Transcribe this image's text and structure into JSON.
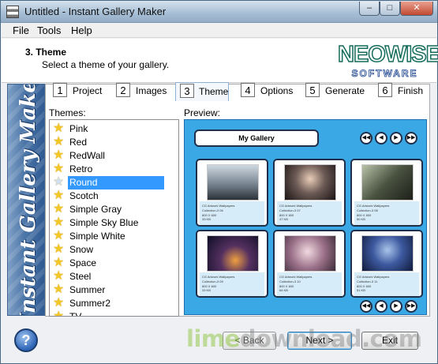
{
  "window": {
    "title": "Untitled - Instant Gallery Maker",
    "controls": {
      "minimize": "–",
      "maximize": "□",
      "close": "✕"
    }
  },
  "menu": [
    "File",
    "Tools",
    "Help"
  ],
  "header": {
    "step_title": "3. Theme",
    "step_desc": "Select a theme of your gallery.",
    "logo_top": "NEOWISE",
    "logo_bottom": "SOFTWARE"
  },
  "sidebar_text": "Instant Gallery Maker",
  "tabs": [
    {
      "num": "1",
      "label": "Project"
    },
    {
      "num": "2",
      "label": "Images"
    },
    {
      "num": "3",
      "label": "Theme",
      "active": true
    },
    {
      "num": "4",
      "label": "Options"
    },
    {
      "num": "5",
      "label": "Generate"
    },
    {
      "num": "6",
      "label": "Finish"
    }
  ],
  "themes_label": "Themes:",
  "preview_label": "Preview:",
  "themes": [
    "Pink",
    "Red",
    "RedWall",
    "Retro",
    "Round",
    "Scotch",
    "Simple Gray",
    "Simple Sky Blue",
    "Simple White",
    "Snow",
    "Space",
    "Steel",
    "Summer",
    "Summer2",
    "TV"
  ],
  "selected_theme": "Round",
  "preview": {
    "gallery_title": "My Gallery",
    "nav": [
      "◀◀",
      "◀",
      "▶",
      "▶▶"
    ],
    "cards": [
      {
        "caption": "CG Artwork Wallpapers",
        "name": "Collection-3 06",
        "size": "800 X 600",
        "kb": "33 KB"
      },
      {
        "caption": "CG Artwork Wallpapers",
        "name": "Collection-3 07",
        "size": "800 X 600",
        "kb": "47 KB"
      },
      {
        "caption": "CG Artwork Wallpapers",
        "name": "Collection-3 08",
        "size": "800 X 600",
        "kb": "50 KB"
      },
      {
        "caption": "CG Artwork Wallpapers",
        "name": "Collection-3 09",
        "size": "800 X 600",
        "kb": "33 KB"
      },
      {
        "caption": "CG Artwork Wallpapers",
        "name": "Collection-3 10",
        "size": "800 X 600",
        "kb": "64 KB"
      },
      {
        "caption": "CG Artwork Wallpapers",
        "name": "Collection-3 11",
        "size": "800 X 600",
        "kb": "51 KB"
      }
    ]
  },
  "buttons": {
    "help": "?",
    "back": "< Back",
    "next": "Next >",
    "exit": "Exit"
  },
  "watermark": {
    "lime": "lime",
    "rest": "download.com"
  }
}
